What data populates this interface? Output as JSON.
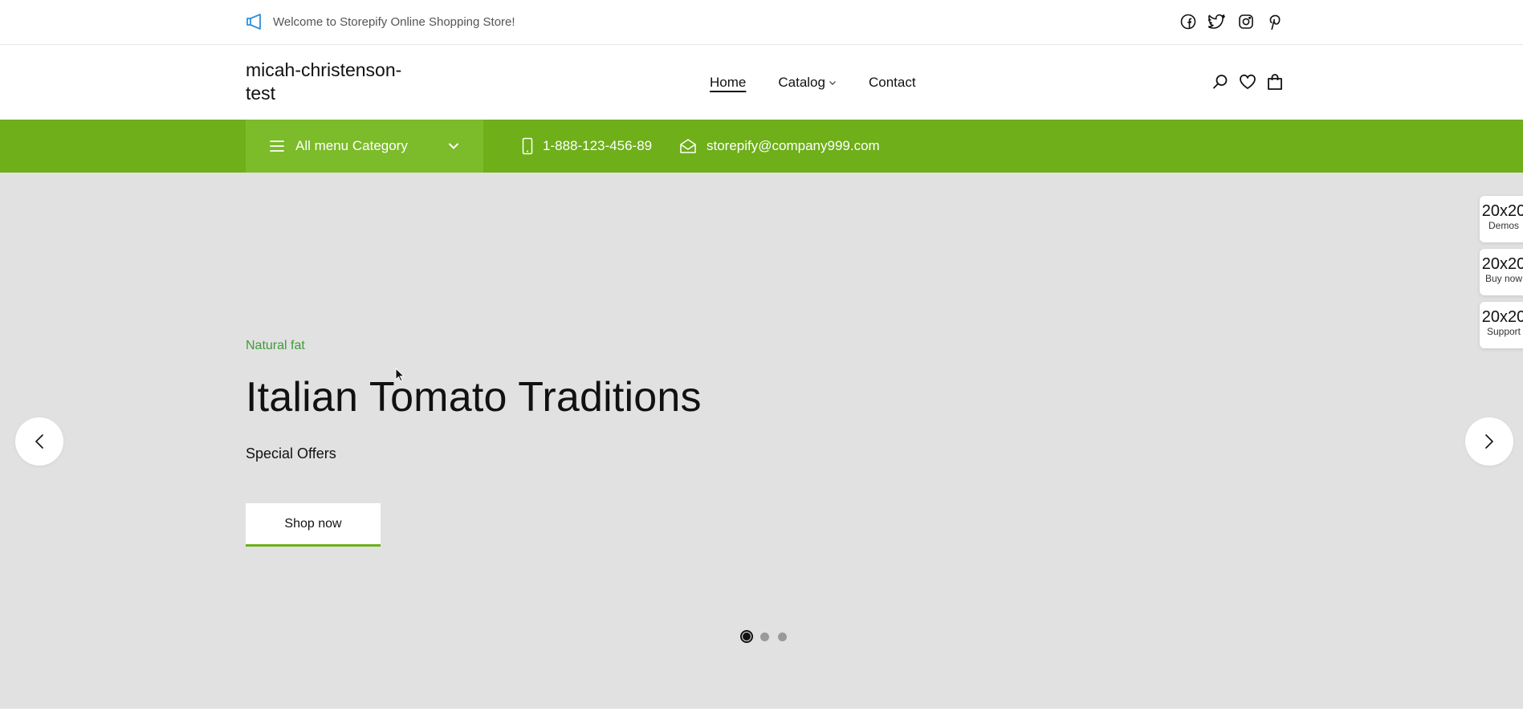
{
  "topbar": {
    "welcome_text": "Welcome to Storepify Online Shopping Store!",
    "socials": [
      "facebook-icon",
      "twitter-icon",
      "instagram-icon",
      "pinterest-icon"
    ]
  },
  "header": {
    "logo_text": "micah-christenson-test",
    "nav": [
      {
        "label": "Home",
        "active": true
      },
      {
        "label": "Catalog",
        "has_dropdown": true
      },
      {
        "label": "Contact"
      }
    ],
    "icons": [
      "search-icon",
      "heart-icon",
      "bag-icon"
    ]
  },
  "greenbar": {
    "category_label": "All menu Category",
    "phone": "1-888-123-456-89",
    "email": "storepify@company999.com",
    "bg_color": "#6eaf1a",
    "category_bg_color": "#7cbb29"
  },
  "hero": {
    "kicker": "Natural fat",
    "title": "Italian Tomato Traditions",
    "subtitle": "Special Offers",
    "button_label": "Shop now",
    "slides_count": 3,
    "active_slide": 1,
    "bg_color": "#e1e1e1",
    "accent_color": "#3f9a3a"
  },
  "side_widgets": [
    {
      "big": "20x20",
      "small": "Demos"
    },
    {
      "big": "20x20",
      "small": "Buy now"
    },
    {
      "big": "20x20",
      "small": "Support"
    }
  ]
}
